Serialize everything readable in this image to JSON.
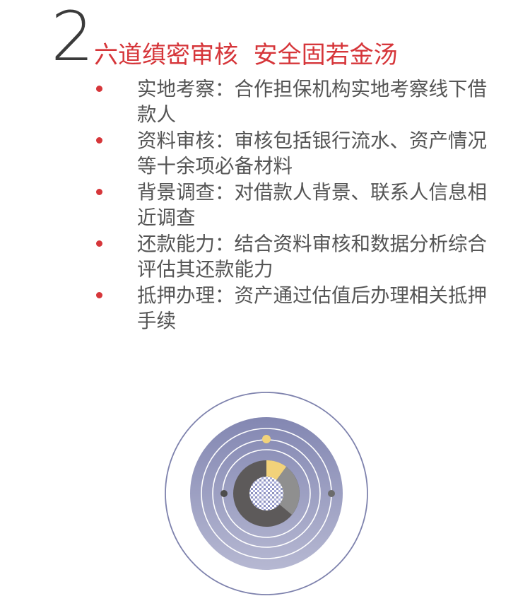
{
  "section": {
    "number": "2",
    "title": "六道缜密审核  安全固若金汤"
  },
  "items": [
    {
      "label": "实地考察",
      "colon": "：",
      "text": "合作担保机构实地考察线下借款人"
    },
    {
      "label": "资料审核",
      "colon": "：",
      "text": "审核包括银行流水、资产情况等十余项必备材料"
    },
    {
      "label": "背景调查",
      "colon": "：",
      "text": "对借款人背景、联系人信息相近调查"
    },
    {
      "label": "还款能力",
      "colon": "：",
      "text": "结合资料审核和数据分析综合评估其还款能力"
    },
    {
      "label": "抵押办理",
      "colon": "：",
      "text": "资产通过估值后办理相关抵押手续"
    }
  ],
  "colors": {
    "accent_red": "#d6363a",
    "number_gray": "#3b3b3b",
    "body_text": "#555555",
    "orbit_blue": "#7e82ad",
    "ring_dark": "#5d5a5a",
    "ring_mid": "#8f8f8f",
    "ring_gold": "#f2d27a"
  }
}
